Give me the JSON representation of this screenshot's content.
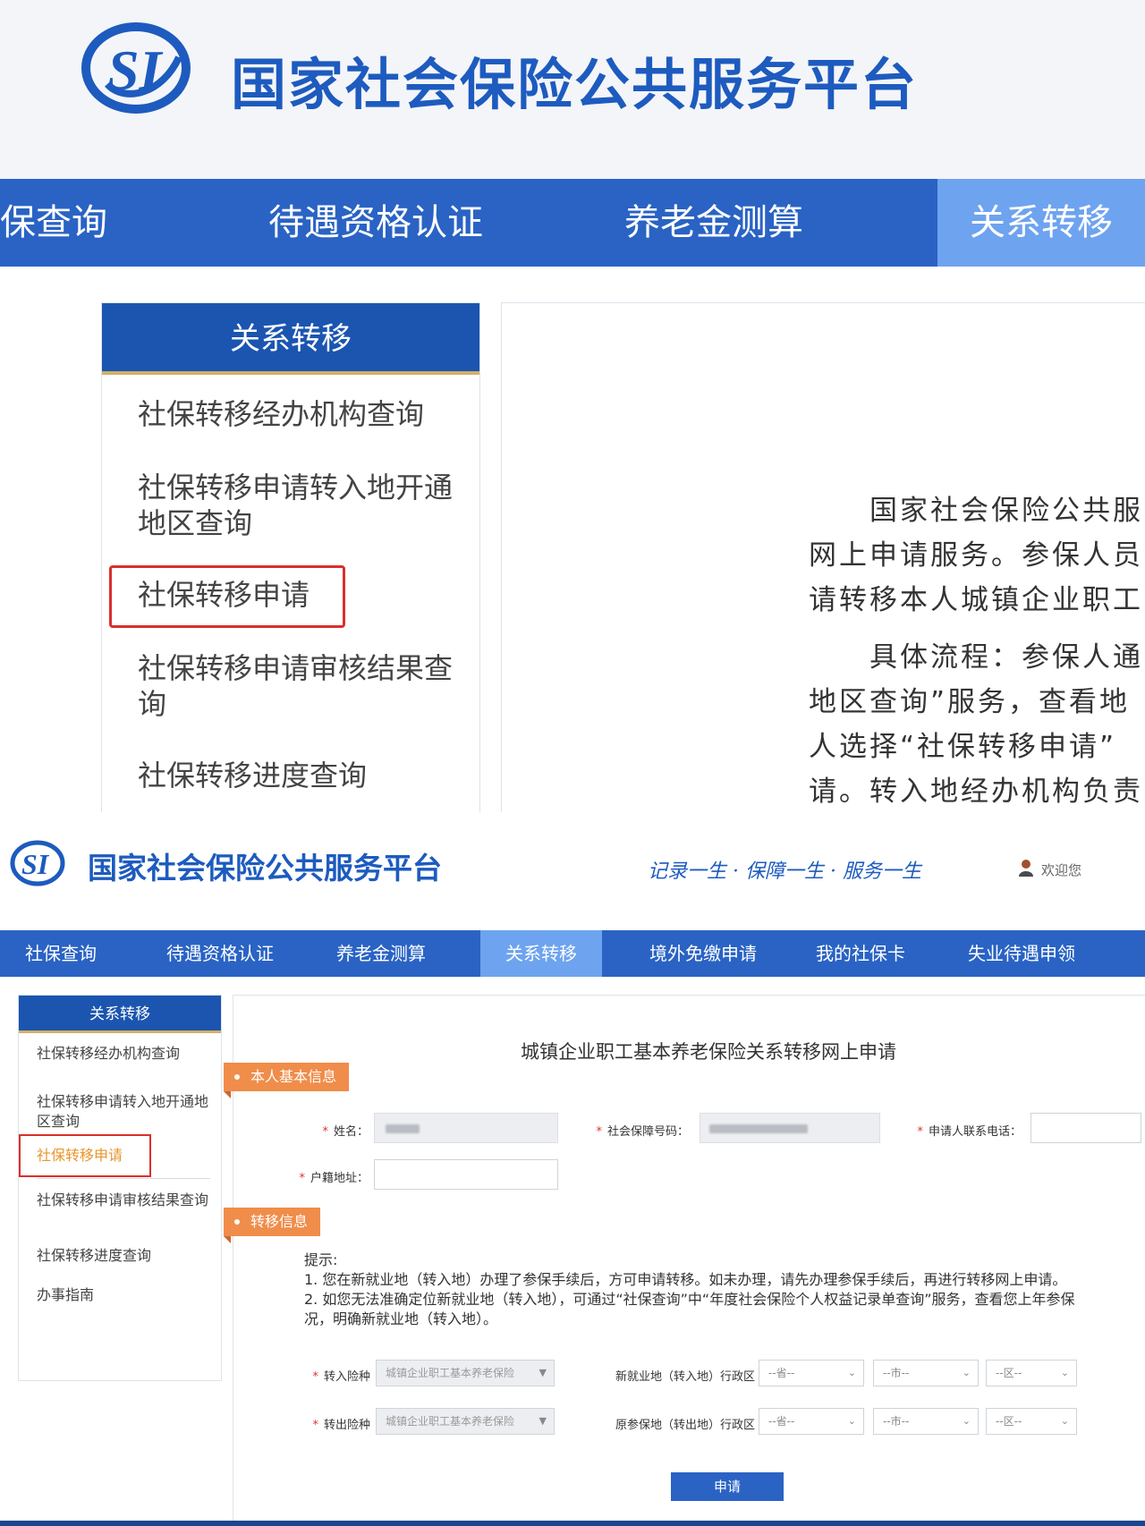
{
  "top": {
    "site_title": "国家社会保险公共服务平台",
    "nav": [
      {
        "label": "保查询"
      },
      {
        "label": "待遇资格认证"
      },
      {
        "label": "养老金测算"
      },
      {
        "label": "关系转移"
      }
    ],
    "sidebar": {
      "title": "关系转移",
      "items": [
        {
          "label": "社保转移经办机构查询"
        },
        {
          "label": "社保转移申请转入地开通地区查询"
        },
        {
          "label": "社保转移申请"
        },
        {
          "label": "社保转移申请审核结果查询"
        },
        {
          "label": "社保转移进度查询"
        }
      ]
    },
    "content_lines": [
      "　　国家社会保险公共服",
      "网上申请服务。参保人员",
      "请转移本人城镇企业职工",
      "　　具体流程：参保人通",
      "地区查询”服务，查看地",
      "人选择“社保转移申请”",
      "请。转入地经办机构负责"
    ]
  },
  "bottom": {
    "site_title": "国家社会保险公共服务平台",
    "slogan": "记录一生 · 保障一生 · 服务一生",
    "welcome": "欢迎您",
    "nav": [
      {
        "label": "社保查询"
      },
      {
        "label": "待遇资格认证"
      },
      {
        "label": "养老金测算"
      },
      {
        "label": "关系转移"
      },
      {
        "label": "境外免缴申请"
      },
      {
        "label": "我的社保卡"
      },
      {
        "label": "失业待遇申领"
      }
    ],
    "sidebar": {
      "title": "关系转移",
      "items": [
        {
          "label": "社保转移经办机构查询"
        },
        {
          "label": "社保转移申请转入地开通地区查询"
        },
        {
          "label": "社保转移申请"
        },
        {
          "label": "社保转移申请审核结果查询"
        },
        {
          "label": "社保转移进度查询"
        },
        {
          "label": "办事指南"
        }
      ]
    },
    "form": {
      "title": "城镇企业职工基本养老保险关系转移网上申请",
      "section_basic": "本人基本信息",
      "name_label": "姓名：",
      "ssn_label": "社会保障号码：",
      "phone_label": "申请人联系电话：",
      "address_label": "户籍地址：",
      "section_transfer": "转移信息",
      "tips": {
        "heading": "提示:",
        "line1": "1. 您在新就业地（转入地）办理了参保手续后，方可申请转移。如未办理，请先办理参保手续后，再进行转移网上申请。",
        "line2": "2. 如您无法准确定位新就业地（转入地），可通过“社保查询”中“年度社会保险个人权益记录单查询”服务，查看您上年参保",
        "line3": "况，明确新就业地（转入地）。"
      },
      "in_type_label": "转入险种",
      "in_type_value": "城镇企业职工基本养老保险",
      "in_region_label": "新就业地（转入地）行政区",
      "out_type_label": "转出险种",
      "out_type_value": "城镇企业职工基本养老保险",
      "out_region_label": "原参保地（转出地）行政区",
      "province": "--省--",
      "city": "--市--",
      "district": "--区--",
      "submit": "申请"
    }
  },
  "colors": {
    "brand_blue": "#2a63c4",
    "active_tab": "#6ea3ef",
    "section_orange": "#f08d4a",
    "highlight_red": "#d9302c"
  }
}
